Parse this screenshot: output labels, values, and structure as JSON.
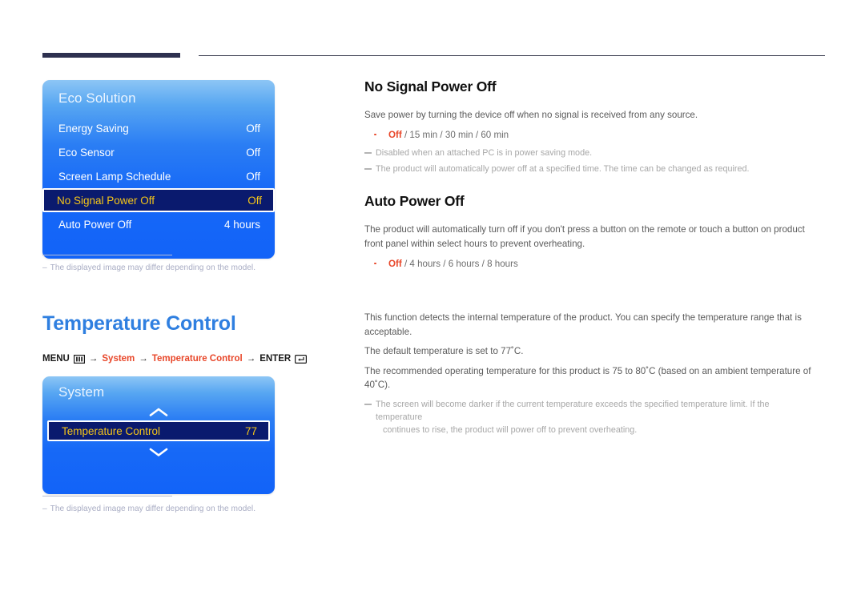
{
  "header": {
    "rule_thick": "#2e3150",
    "rule_thin": "#3c3f52"
  },
  "osd_panels": [
    {
      "id": "eco",
      "title": "Eco Solution",
      "rows": [
        {
          "label": "Energy Saving",
          "value": "Off",
          "selected": false
        },
        {
          "label": "Eco Sensor",
          "value": "Off",
          "selected": false
        },
        {
          "label": "Screen Lamp Schedule",
          "value": "Off",
          "selected": false
        },
        {
          "label": "No Signal Power Off",
          "value": "Off",
          "selected": true
        },
        {
          "label": "Auto Power Off",
          "value": "4 hours",
          "selected": false
        }
      ]
    },
    {
      "id": "system",
      "title": "System",
      "rows": [
        {
          "label": "Temperature Control",
          "value": "77",
          "selected": true
        }
      ],
      "scroll_up_icon": "chevron-up-icon",
      "scroll_down_icon": "chevron-down-icon"
    }
  ],
  "panel_notes": {
    "dash": "–",
    "text": "The displayed image may differ depending on the model."
  },
  "section": {
    "title": "Temperature Control",
    "title_color": "#2f7fe0"
  },
  "menu_path": {
    "menu_label": "MENU",
    "menu_icon": "menu-grid-icon",
    "arrow": "→",
    "step1": "System",
    "step2": "Temperature Control",
    "enter_label": "ENTER",
    "enter_icon": "enter-key-icon",
    "accent": "#e8472a"
  },
  "no_signal": {
    "heading": "No Signal Power Off",
    "body": "Save power by turning the device off when no signal is received from any source.",
    "options": [
      {
        "first": "Off",
        "rest": " / 15 min / 30 min / 60 min"
      }
    ],
    "notes": [
      "Disabled when an attached PC is in power saving mode.",
      "The product will automatically power off at a specified time. The time can be changed as required."
    ]
  },
  "auto_power_off": {
    "heading": "Auto Power Off",
    "body": "The product will automatically turn off if you don't press a button on the remote or touch a button on product front panel within select hours to prevent overheating.",
    "options": [
      {
        "first": "Off",
        "rest": " / 4 hours / 6 hours / 8 hours"
      }
    ]
  },
  "temperature_control": {
    "lines": [
      "This function detects the internal temperature of the product. You can specify the temperature range that is acceptable.",
      "The default temperature is set to 77˚C.",
      "The recommended operating temperature for this product is 75 to 80˚C (based on an ambient temperature of 40˚C)."
    ],
    "note": "The screen will become darker if the current temperature exceeds the specified temperature limit. If the temperature",
    "note_cont": "continues to rise, the product will power off to prevent overheating."
  }
}
